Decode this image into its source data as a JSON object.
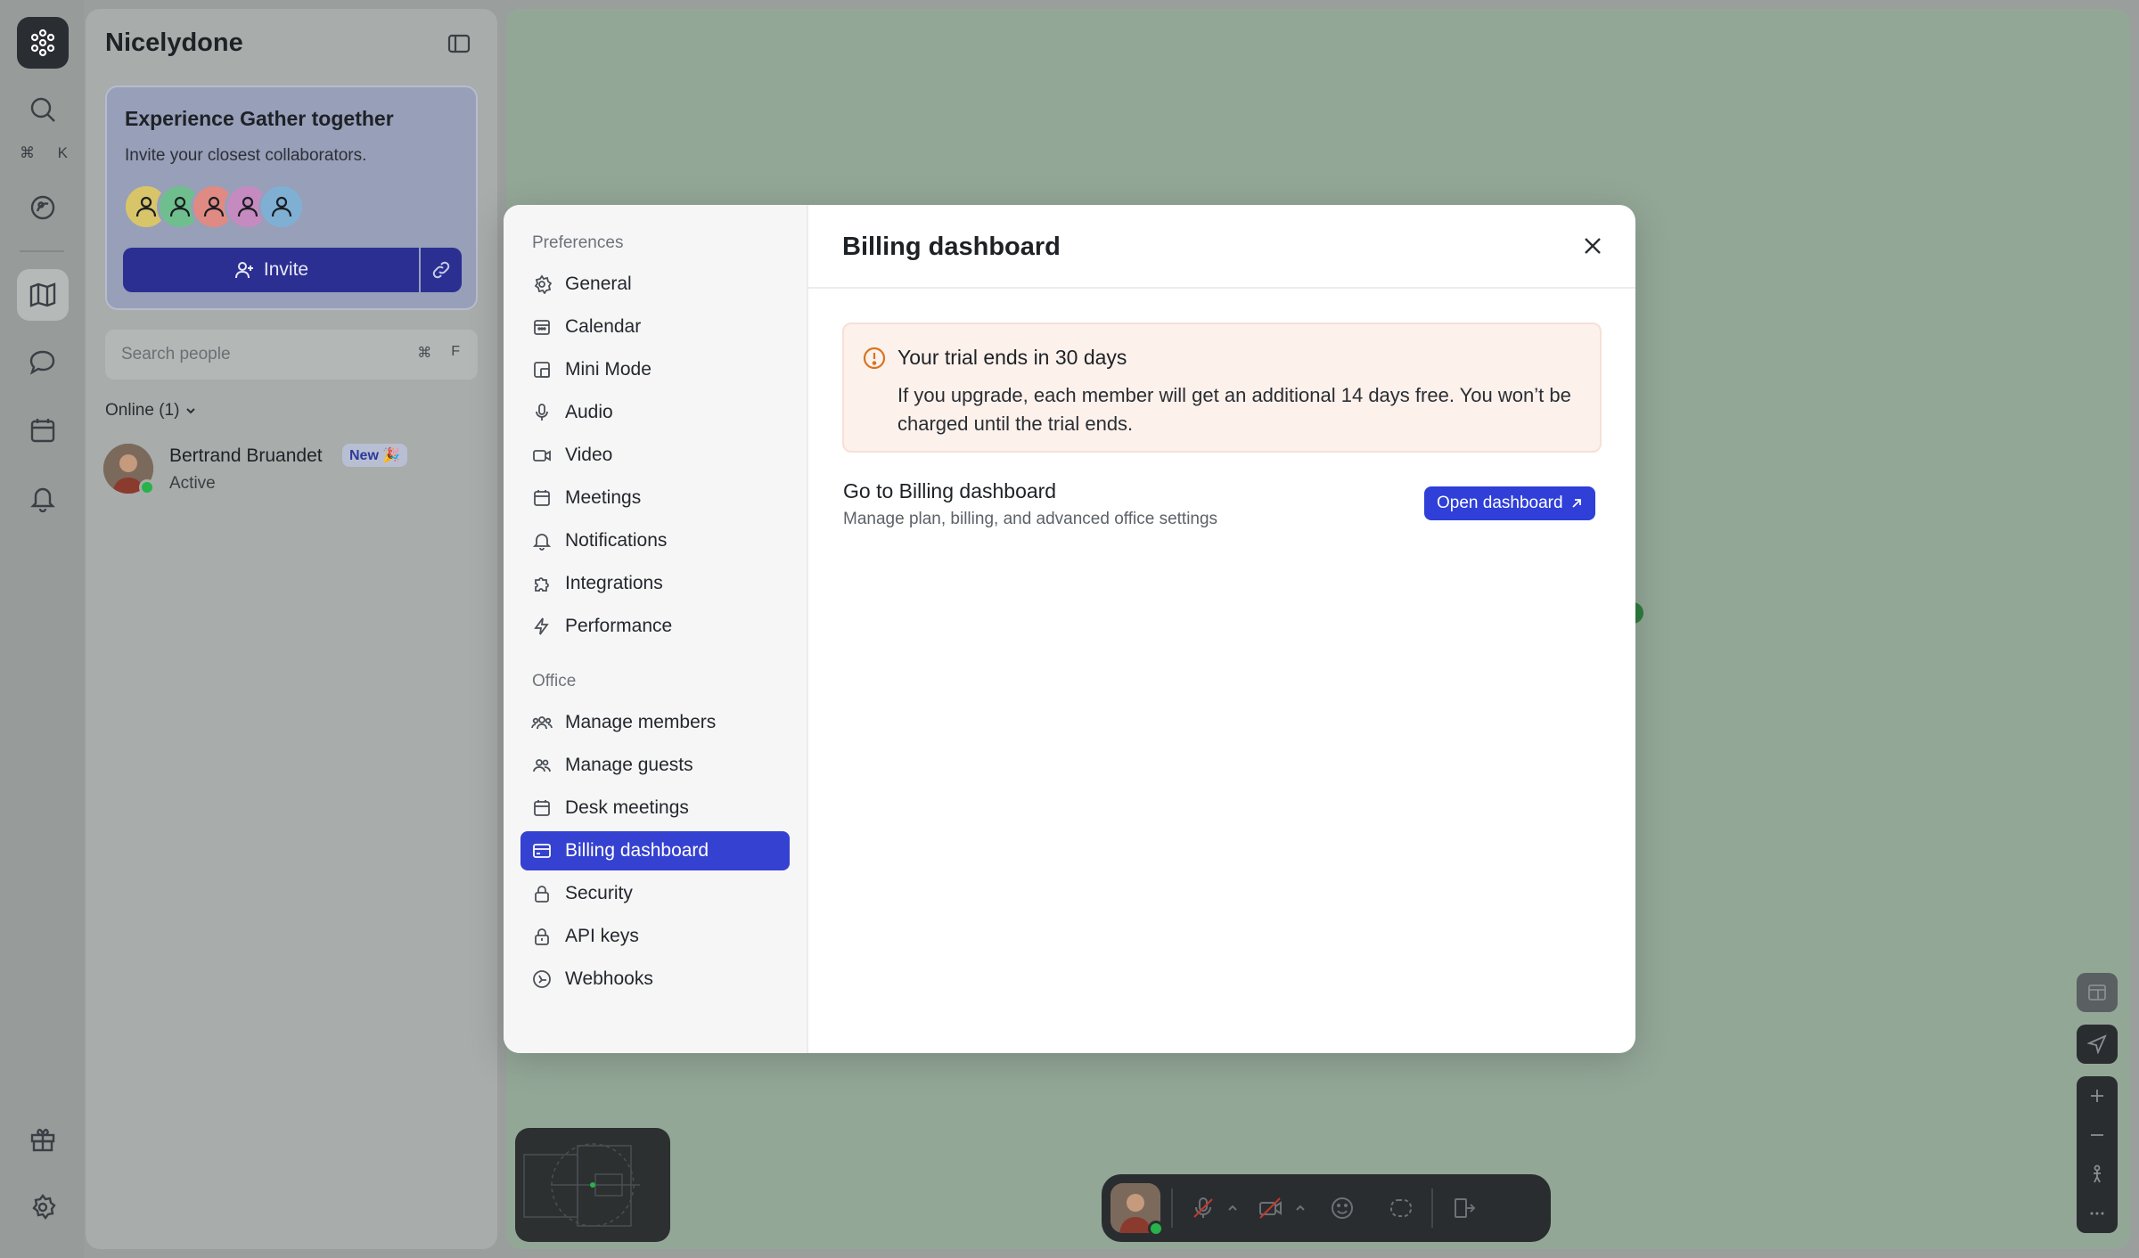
{
  "rail": {
    "kbd_cmd": "⌘",
    "kbd_k": "K"
  },
  "sidebar": {
    "title": "Nicelydone",
    "promo": {
      "title": "Experience Gather together",
      "subtitle": "Invite your closest collaborators.",
      "invite_label": "Invite",
      "avatar_colors": [
        "#d8c56a",
        "#6fbf8e",
        "#e08a84",
        "#c58bc0",
        "#7fb0d4"
      ]
    },
    "search": {
      "placeholder": "Search people",
      "kbd_cmd": "⌘",
      "kbd_key": "F"
    },
    "online_header": "Online (1)",
    "user": {
      "name": "Bertrand Bruandet",
      "badge": "New 🎉",
      "status": "Active"
    }
  },
  "modal": {
    "title": "Billing dashboard",
    "nav": {
      "preferences_label": "Preferences",
      "office_label": "Office",
      "preferences": [
        {
          "label": "General",
          "icon": "gear-icon"
        },
        {
          "label": "Calendar",
          "icon": "calendar-icon"
        },
        {
          "label": "Mini Mode",
          "icon": "mini-mode-icon"
        },
        {
          "label": "Audio",
          "icon": "microphone-icon"
        },
        {
          "label": "Video",
          "icon": "video-icon"
        },
        {
          "label": "Meetings",
          "icon": "calendar-icon"
        },
        {
          "label": "Notifications",
          "icon": "bell-icon"
        },
        {
          "label": "Integrations",
          "icon": "puzzle-icon"
        },
        {
          "label": "Performance",
          "icon": "lightning-icon"
        }
      ],
      "office": [
        {
          "label": "Manage members",
          "icon": "users-icon"
        },
        {
          "label": "Manage guests",
          "icon": "guests-icon"
        },
        {
          "label": "Desk meetings",
          "icon": "calendar-icon"
        },
        {
          "label": "Billing dashboard",
          "icon": "billing-icon",
          "selected": true
        },
        {
          "label": "Security",
          "icon": "lock-icon"
        },
        {
          "label": "API keys",
          "icon": "lock-icon"
        },
        {
          "label": "Webhooks",
          "icon": "webhook-icon"
        }
      ]
    },
    "trial": {
      "title": "Your trial ends in 30 days",
      "body": "If you upgrade, each member will get an additional 14 days free. You won’t be charged until the trial ends."
    },
    "billing": {
      "title": "Go to Billing dashboard",
      "subtitle": "Manage plan, billing, and advanced office settings",
      "button_label": "Open dashboard"
    }
  },
  "colors": {
    "accent": "#3541d0",
    "warning": "#d8731f",
    "online": "#27b24a"
  }
}
